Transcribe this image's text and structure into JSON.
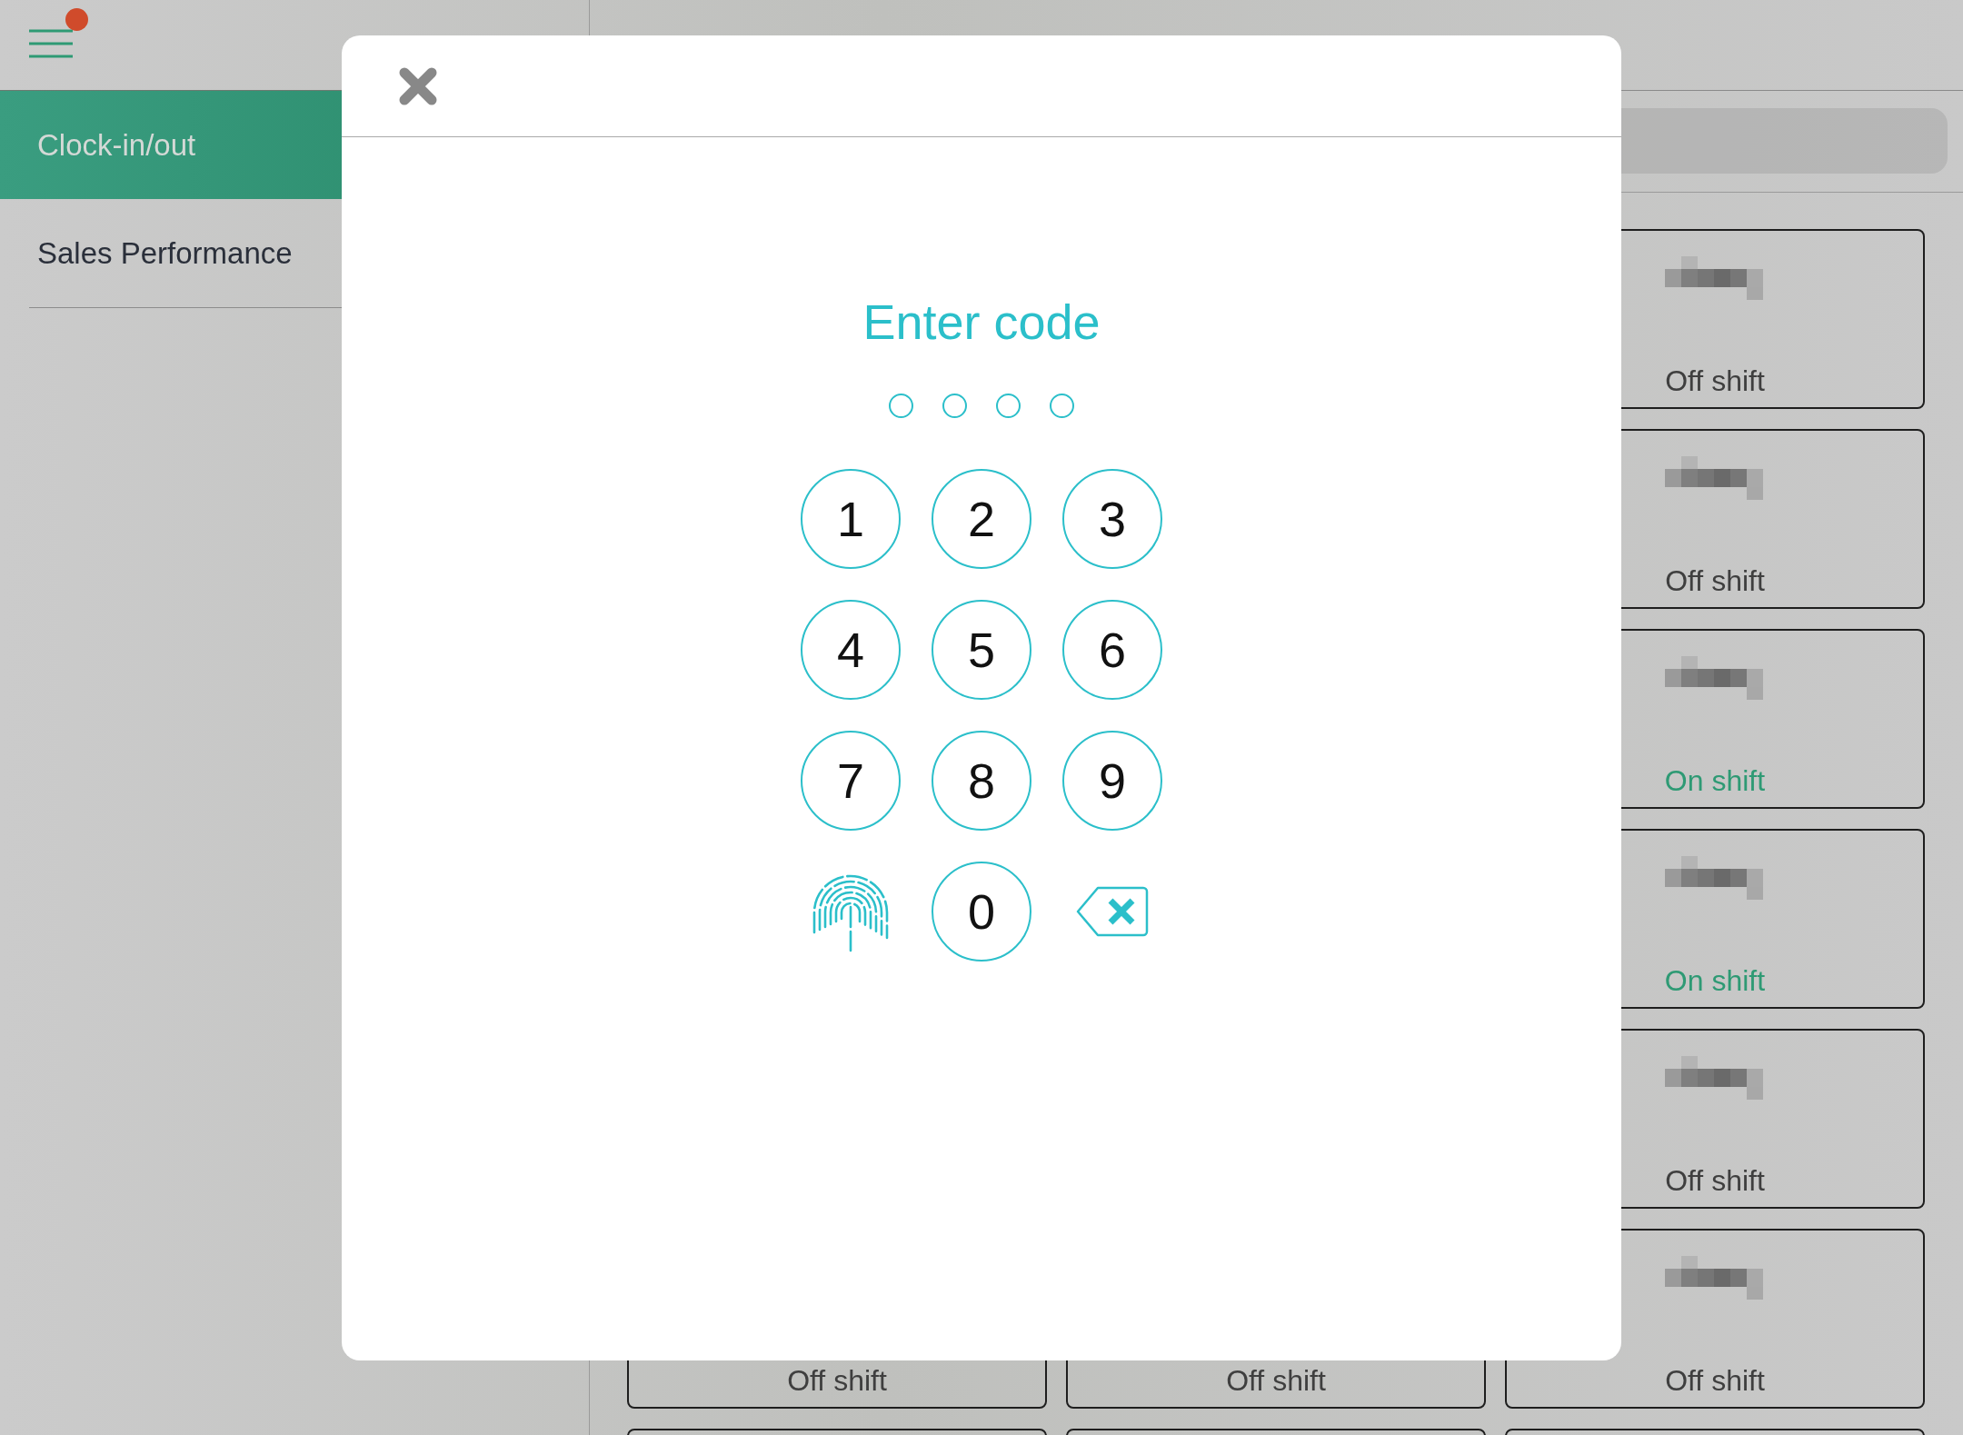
{
  "menu": {
    "notification": true
  },
  "sidebar": {
    "items": [
      {
        "label": "Clock-in/out",
        "selected": true
      },
      {
        "label": "Sales Performance",
        "selected": false
      }
    ]
  },
  "card_rows": [
    {
      "cards": [
        {
          "kind": "employee",
          "status": "Off shift",
          "on_shift": false
        }
      ]
    },
    {
      "cards": [
        {
          "kind": "employee",
          "status": "Off shift",
          "on_shift": false
        }
      ]
    },
    {
      "cards": [
        {
          "kind": "employee",
          "status": "On shift",
          "on_shift": true
        }
      ]
    },
    {
      "cards": [
        {
          "kind": "employee",
          "status": "On shift",
          "on_shift": true
        }
      ]
    },
    {
      "cards": [
        {
          "kind": "employee",
          "status": "Off shift",
          "on_shift": false
        }
      ]
    },
    {
      "cards": [
        {
          "kind": "employee",
          "status": "Off shift",
          "on_shift": false
        },
        {
          "kind": "employee",
          "status": "Off shift",
          "on_shift": false
        },
        {
          "kind": "employee",
          "status": "Off shift",
          "on_shift": false
        }
      ]
    },
    {
      "cards": [
        {
          "kind": "empty"
        },
        {
          "kind": "empty"
        },
        {
          "kind": "empty"
        }
      ]
    }
  ],
  "code_dialog": {
    "title": "Enter code",
    "pin_dots": [
      {
        "filled": false
      },
      {
        "filled": false
      },
      {
        "filled": false
      },
      {
        "filled": false
      }
    ],
    "keys": [
      {
        "kind": "digit",
        "label": "1"
      },
      {
        "kind": "digit",
        "label": "2"
      },
      {
        "kind": "digit",
        "label": "3"
      },
      {
        "kind": "digit",
        "label": "4"
      },
      {
        "kind": "digit",
        "label": "5"
      },
      {
        "kind": "digit",
        "label": "6"
      },
      {
        "kind": "digit",
        "label": "7"
      },
      {
        "kind": "digit",
        "label": "8"
      },
      {
        "kind": "digit",
        "label": "9"
      },
      {
        "kind": "fingerprint"
      },
      {
        "kind": "digit",
        "label": "0"
      },
      {
        "kind": "backspace"
      }
    ]
  }
}
